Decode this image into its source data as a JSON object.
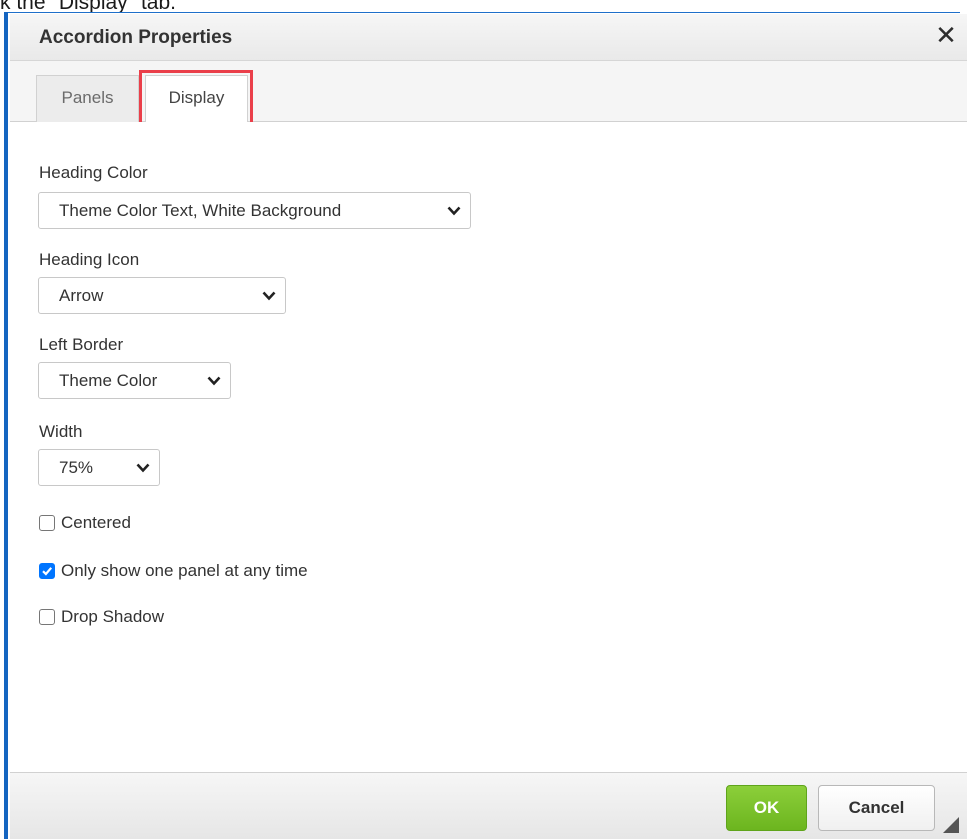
{
  "instruction": "k the \"Display\" tab.",
  "dialog": {
    "title": "Accordion Properties",
    "close_icon": "close-icon"
  },
  "tabs": [
    {
      "label": "Panels",
      "active": false
    },
    {
      "label": "Display",
      "active": true
    }
  ],
  "highlight_color": "#ea3f4a",
  "fields": {
    "heading_color": {
      "label": "Heading Color",
      "value": "Theme Color Text, White Background"
    },
    "heading_icon": {
      "label": "Heading Icon",
      "value": "Arrow"
    },
    "left_border": {
      "label": "Left Border",
      "value": "Theme Color"
    },
    "width": {
      "label": "Width",
      "value": "75%"
    }
  },
  "checkboxes": [
    {
      "label": "Centered",
      "checked": false
    },
    {
      "label": "Only show one panel at any time",
      "checked": true
    },
    {
      "label": "Drop Shadow",
      "checked": false
    }
  ],
  "buttons": {
    "ok": "OK",
    "cancel": "Cancel"
  },
  "colors": {
    "ok_button": "#7dc12c",
    "checkbox_checked": "#0075ff",
    "dialog_border": "#1565c0"
  }
}
